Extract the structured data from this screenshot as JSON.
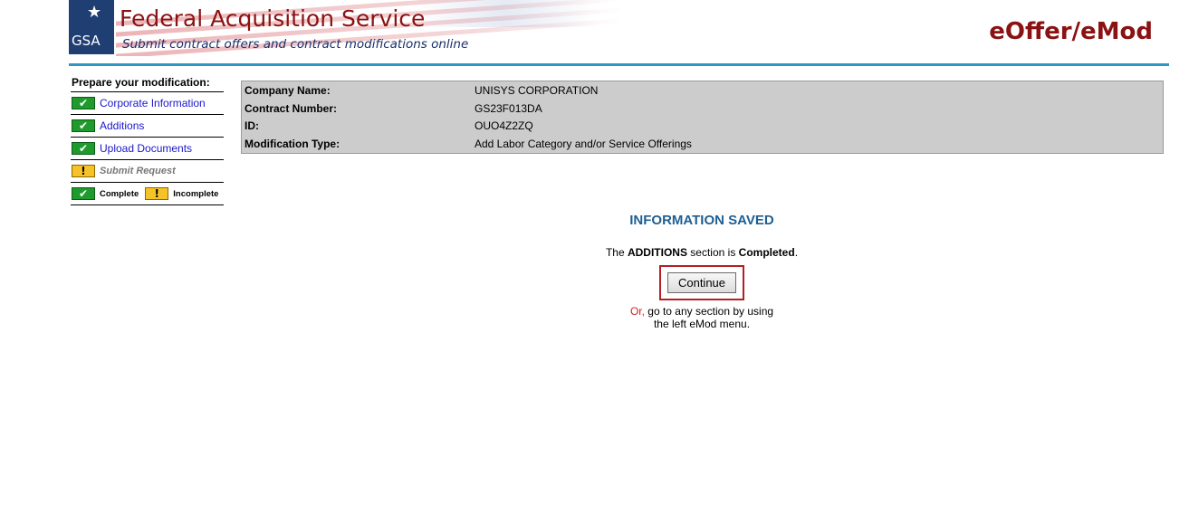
{
  "header": {
    "logo_text": "GSA",
    "title": "Federal Acquisition Service",
    "subtitle": "Submit contract offers and contract modifications online",
    "app_name": "eOffer/eMod"
  },
  "sidebar": {
    "title": "Prepare your modification:",
    "items": [
      {
        "label": "Corporate Information",
        "status": "complete"
      },
      {
        "label": "Additions",
        "status": "complete"
      },
      {
        "label": "Upload Documents",
        "status": "complete"
      },
      {
        "label": "Submit Request",
        "status": "incomplete"
      }
    ],
    "legend": {
      "complete_label": "Complete",
      "incomplete_label": "Incomplete"
    }
  },
  "info": {
    "rows": [
      {
        "label": "Company Name:",
        "value": "UNISYS CORPORATION"
      },
      {
        "label": "Contract Number:",
        "value": "GS23F013DA"
      },
      {
        "label": "ID:",
        "value": "OUO4Z2ZQ"
      },
      {
        "label": "Modification Type:",
        "value": "Add Labor Category and/or Service Offerings"
      }
    ]
  },
  "saved": {
    "heading": "INFORMATION SAVED",
    "msg_prefix": "The ",
    "msg_section": "ADDITIONS",
    "msg_middle": " section is ",
    "msg_status": "Completed",
    "msg_suffix": ".",
    "continue_label": "Continue",
    "or_word": "Or,",
    "or_line1": " go to any section by using",
    "or_line2": "the left eMod menu."
  },
  "colors": {
    "brand_red": "#8a1212",
    "rule_blue": "#2f97c6",
    "complete_green": "#1f9a2d",
    "incomplete_yellow": "#f5c227",
    "highlight_red": "#b21e24"
  },
  "icons": {
    "complete": "checkmark-icon",
    "incomplete": "exclamation-icon"
  }
}
